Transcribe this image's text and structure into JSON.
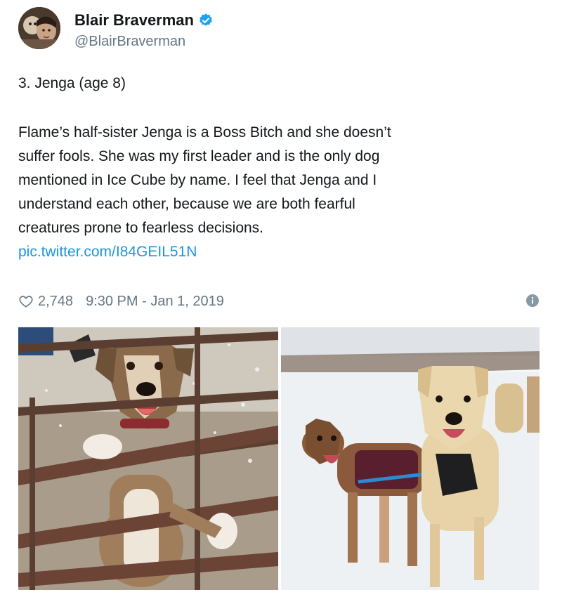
{
  "author": {
    "name": "Blair Braverman",
    "handle": "@BlairBraverman",
    "verified_icon": "verified-badge-icon"
  },
  "tweet": {
    "heading": "3. Jenga (age 8)",
    "lines": [
      "Flame’s half-sister Jenga is a Boss Bitch and she doesn’t",
      "suffer fools. She was my first leader and is the only dog",
      "mentioned in Ice Cube by name. I feel that Jenga and I",
      "understand each other, because we are both fearful",
      "creatures prone to fearless decisions."
    ],
    "link": "pic.twitter.com/I84GEIL51N"
  },
  "meta": {
    "likes": "2,748",
    "timestamp": "9:30 PM - Jan 1, 2019"
  },
  "colors": {
    "link": "#1b95e0",
    "verified": "#1da1f2",
    "muted": "#657786"
  }
}
